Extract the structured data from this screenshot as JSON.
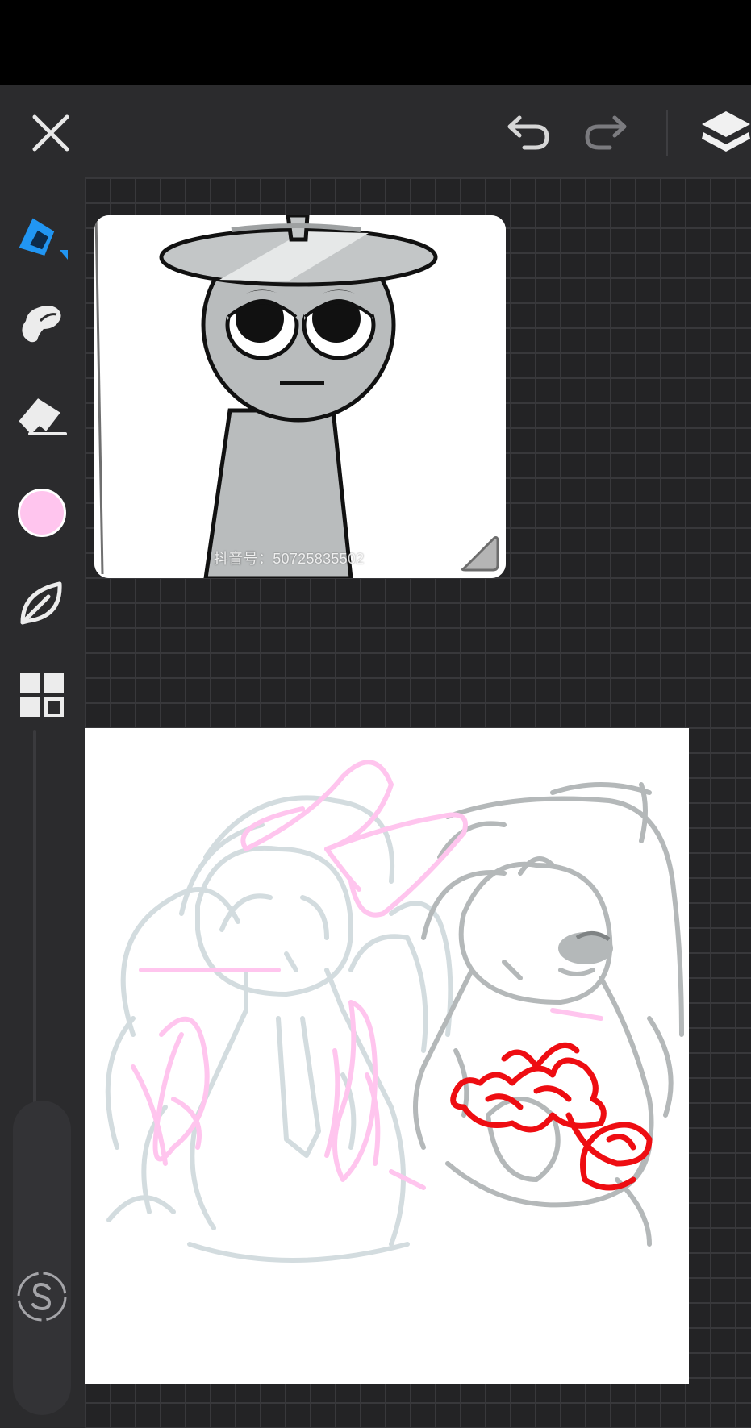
{
  "reference": {
    "watermark": "抖音号：50725835502"
  },
  "brush": {
    "color": "#ffc5ee"
  },
  "colors": {
    "accent": "#2196f3",
    "toolbar": "#2b2b2d",
    "canvas_background": "#232325"
  },
  "icons": {
    "close": "x-icon",
    "undo": "undo-icon",
    "redo": "redo-icon",
    "layers": "layers-icon",
    "pen": "pen-icon",
    "smudge": "smudge-icon",
    "eraser": "eraser-icon",
    "color": "color-swatch",
    "brush_library": "leaf-icon",
    "gallery": "grid-icon",
    "symmetry": "s-icon"
  }
}
